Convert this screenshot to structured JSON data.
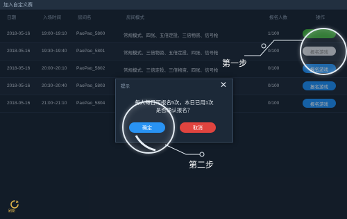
{
  "window": {
    "title": "加入自定义赛"
  },
  "table": {
    "headers": [
      "日期",
      "入场时间",
      "房间名",
      "房间模式",
      "报名人数",
      "操作"
    ],
    "rows": [
      {
        "date": "2018-05-16",
        "time": "19:00~19:10",
        "room": "PaoPao_5800",
        "mode": "常规模式、四张、五倍定投、三倍物资、信号枪",
        "count": "1/100",
        "action": "",
        "style": "green"
      },
      {
        "date": "2018-05-16",
        "time": "19:30~19:40",
        "room": "PaoPao_5801",
        "mode": "常规模式、三倍物资、五倍定投、四张、信号枪",
        "count": "0/100",
        "action": "报名游戏",
        "style": "gray"
      },
      {
        "date": "2018-05-16",
        "time": "20:00~20:10",
        "room": "PaoPao_5802",
        "mode": "常规模式、三倍定投、三倍物资、四张、信号枪",
        "count": "0/100",
        "action": "报名游戏",
        "style": "blue"
      },
      {
        "date": "2018-05-16",
        "time": "20:30~20:40",
        "room": "PaoPao_5803",
        "mode": "",
        "count": "0/100",
        "action": "报名游戏",
        "style": "blue"
      },
      {
        "date": "2018-05-16",
        "time": "21:00~21:10",
        "room": "PaoPao_5804",
        "mode": "",
        "count": "0/100",
        "action": "报名游戏",
        "style": "blue"
      }
    ]
  },
  "dialog": {
    "title": "提示",
    "close": "✕",
    "message_line1": "每人每日可报名5次，本日已用1次",
    "message_line2": "是否确认报名？",
    "ok": "确定",
    "cancel": "取消"
  },
  "annotations": {
    "step1": "第一步",
    "step2": "第二步"
  },
  "footer": {
    "refresh_label": "刷新"
  },
  "colors": {
    "primary": "#1e8ef3",
    "danger": "#e0443f",
    "success": "#3fae3d"
  }
}
